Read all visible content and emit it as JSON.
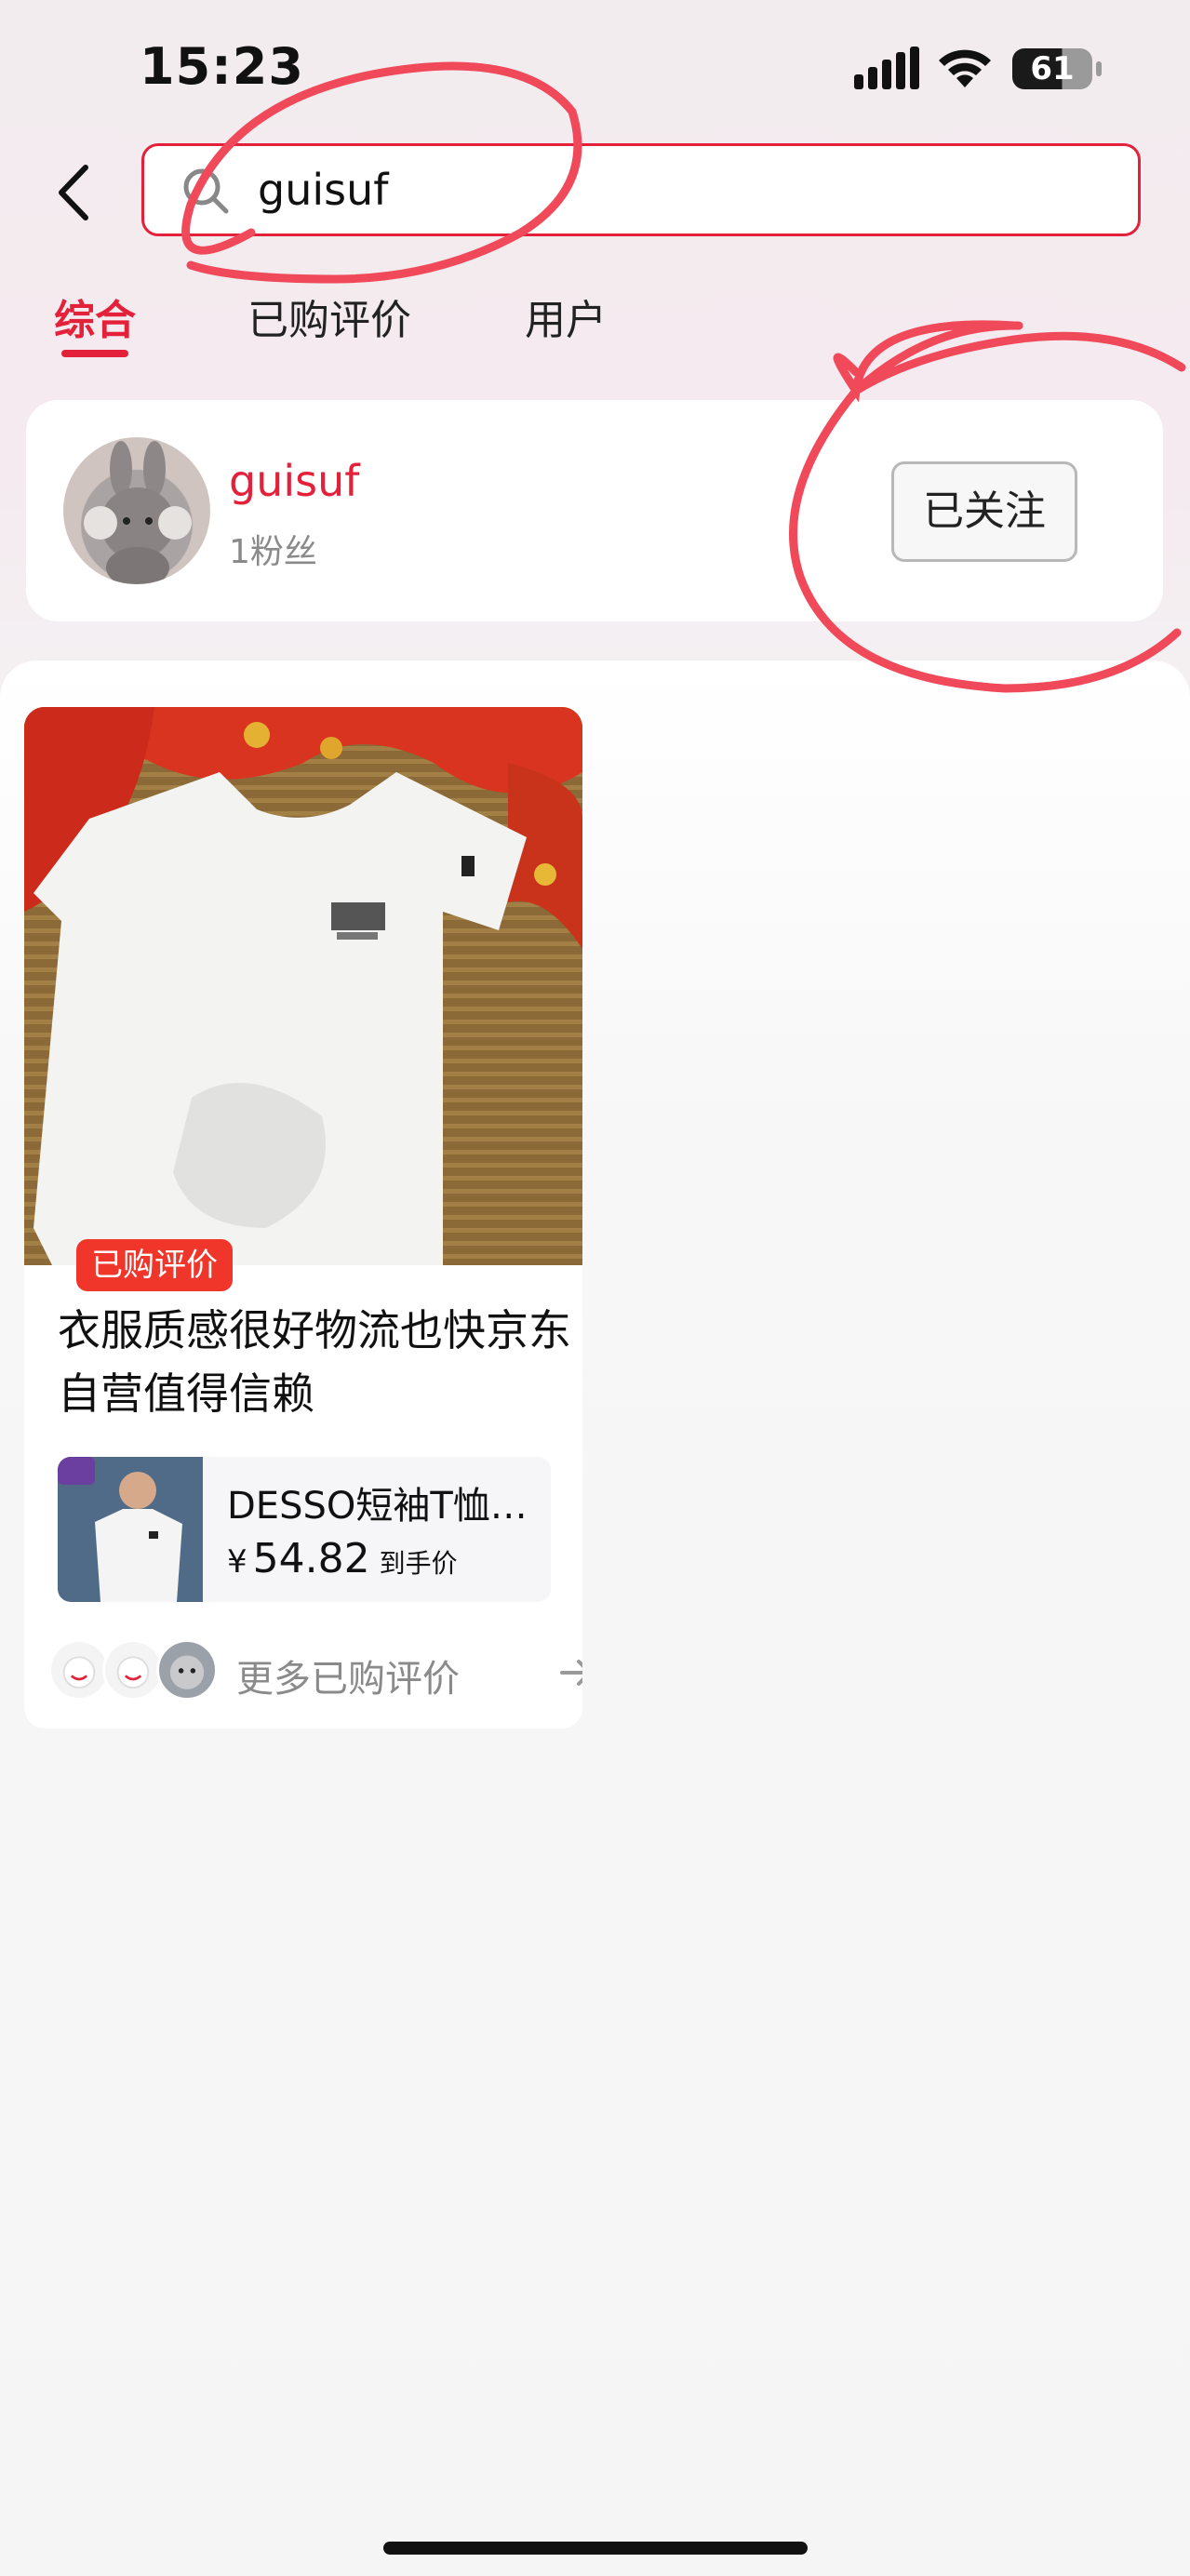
{
  "status_bar": {
    "time": "15:23",
    "battery_level": "61"
  },
  "search": {
    "query": "guisuf"
  },
  "tabs": [
    {
      "label": "综合",
      "active": true
    },
    {
      "label": "已购评价",
      "active": false
    },
    {
      "label": "用户",
      "active": false
    }
  ],
  "user_result": {
    "name": "guisuf",
    "fans": "1粉丝",
    "follow_label": "已关注"
  },
  "review": {
    "badge": "已购评价",
    "title": "衣服质感很好物流也快京东自营值得信赖",
    "product": {
      "name": "DESSO短袖T恤…",
      "currency": "¥",
      "price": "54.82",
      "price_note": "到手价"
    },
    "more_label": "更多已购评价"
  },
  "colors": {
    "accent": "#e3213a",
    "badge": "#f0362b",
    "annotation": "#f0495a"
  }
}
